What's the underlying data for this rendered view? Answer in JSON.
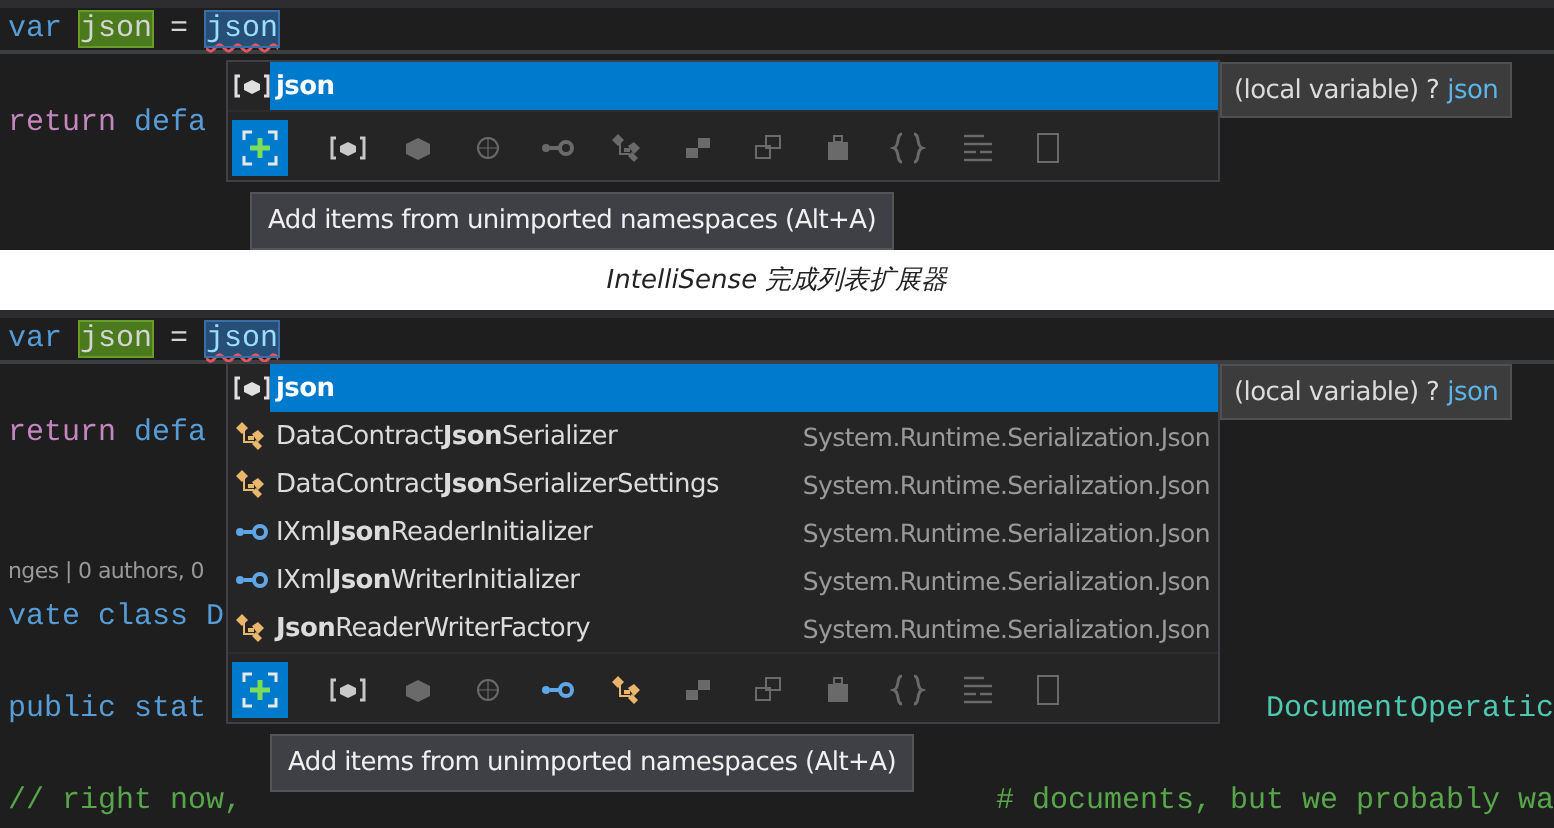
{
  "panels": [
    {
      "code_lines": [
        {
          "kind": "code",
          "left": [
            {
              "text": "var",
              "kind": "keyword"
            },
            {
              "text": "json",
              "kind": "highlight"
            },
            {
              "text": "=",
              "kind": "plain"
            },
            {
              "text": "json",
              "kind": "typed"
            }
          ]
        },
        {
          "kind": "blank"
        },
        {
          "kind": "code",
          "left": [
            {
              "text": "return",
              "kind": "control"
            },
            {
              "text": "defa",
              "kind": "keyword"
            }
          ]
        }
      ],
      "completion": {
        "items": [
          {
            "kind": "local",
            "name": "**json**",
            "selected": true
          }
        ],
        "add_button": {
          "selected": true
        },
        "filters": [
          {
            "kind": "local",
            "on": false
          },
          {
            "kind": "cube",
            "on": false
          },
          {
            "kind": "sphere",
            "on": false
          },
          {
            "kind": "interface",
            "on": false
          },
          {
            "kind": "class",
            "on": false
          },
          {
            "kind": "stack",
            "on": false
          },
          {
            "kind": "windows",
            "on": false
          },
          {
            "kind": "lock",
            "on": false
          },
          {
            "kind": "braces",
            "on": false
          },
          {
            "kind": "lines",
            "on": false
          },
          {
            "kind": "page",
            "on": false
          }
        ],
        "detail": [
          {
            "text": "(local variable) ?",
            "kind": "plain"
          },
          {
            "text": "json",
            "kind": "link"
          }
        ],
        "hint": "Add items from unimported namespaces (Alt+A)"
      }
    },
    {
      "code_lines": [
        {
          "kind": "code",
          "left": [
            {
              "text": "var",
              "kind": "keyword"
            },
            {
              "text": "json",
              "kind": "highlight"
            },
            {
              "text": "=",
              "kind": "plain"
            },
            {
              "text": "json",
              "kind": "typed"
            }
          ]
        },
        {
          "kind": "blank"
        },
        {
          "kind": "code",
          "left": [
            {
              "text": "return",
              "kind": "control"
            },
            {
              "text": "defa",
              "kind": "keyword"
            }
          ]
        },
        {
          "kind": "blank"
        },
        {
          "kind": "blank"
        },
        {
          "kind": "code",
          "left": [
            {
              "text": "nges | 0 authors, 0",
              "kind": "lens"
            }
          ]
        },
        {
          "kind": "code",
          "left": [
            {
              "text": "vate class D",
              "kind": "keyword"
            }
          ]
        },
        {
          "kind": "blank"
        },
        {
          "kind": "code",
          "left": [
            {
              "text": "public stat",
              "kind": "keyword"
            }
          ],
          "right": [
            {
              "text": "DocumentOperatic",
              "kind": "type"
            }
          ]
        },
        {
          "kind": "blank"
        },
        {
          "kind": "code",
          "left": [
            {
              "text": "// right now,",
              "kind": "comment"
            }
          ],
          "right": [
            {
              "text": "# documents, but we probably wa",
              "kind": "comment"
            }
          ]
        }
      ],
      "completion": {
        "items": [
          {
            "kind": "local",
            "name": "**json**",
            "selected": true
          },
          {
            "kind": "class",
            "name": "DataContract**Json**Serializer",
            "namespace": "System.Runtime.Serialization.Json",
            "selected": false
          },
          {
            "kind": "class",
            "name": "DataContract**Json**SerializerSettings",
            "namespace": "System.Runtime.Serialization.Json",
            "selected": false
          },
          {
            "kind": "interface",
            "name": "IXml**Json**ReaderInitializer",
            "namespace": "System.Runtime.Serialization.Json",
            "selected": false
          },
          {
            "kind": "interface",
            "name": "IXml**Json**WriterInitializer",
            "namespace": "System.Runtime.Serialization.Json",
            "selected": false
          },
          {
            "kind": "class",
            "name": "**Json**ReaderWriterFactory",
            "namespace": "System.Runtime.Serialization.Json",
            "selected": false
          }
        ],
        "add_button": {
          "selected": true
        },
        "filters": [
          {
            "kind": "local",
            "on": false
          },
          {
            "kind": "cube",
            "on": false
          },
          {
            "kind": "sphere",
            "on": false
          },
          {
            "kind": "interface",
            "on": true
          },
          {
            "kind": "class",
            "on": true
          },
          {
            "kind": "stack",
            "on": false
          },
          {
            "kind": "windows",
            "on": false
          },
          {
            "kind": "lock",
            "on": false
          },
          {
            "kind": "braces",
            "on": false
          },
          {
            "kind": "lines",
            "on": false
          },
          {
            "kind": "page",
            "on": false
          }
        ],
        "detail": [
          {
            "text": "(local variable) ?",
            "kind": "plain"
          },
          {
            "text": "json",
            "kind": "link"
          }
        ],
        "hint": "Add items from unimported namespaces (Alt+A)"
      }
    }
  ],
  "caption": "IntelliSense 完成列表扩展器"
}
